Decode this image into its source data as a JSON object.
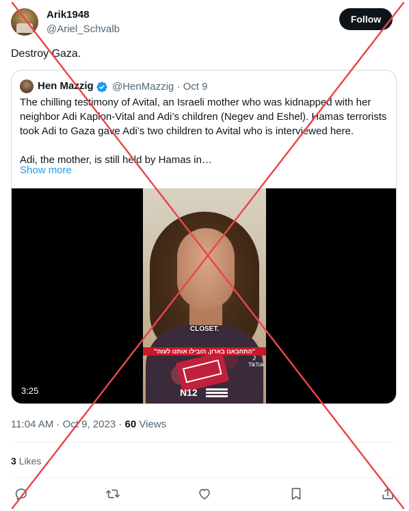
{
  "author": {
    "display_name": "Arik1948",
    "handle": "@Ariel_Schvalb",
    "follow_label": "Follow"
  },
  "tweet": {
    "text": "Destroy Gaza."
  },
  "quoted": {
    "display_name": "Hen Mazzig",
    "meta": "@HenMazzig · Oct 9",
    "paragraph1": "The chilling testimony of Avital, an Israeli mother who was kidnapped with her neighbor Adi Kaplon-Vital and Adi’s children (Negev and Eshel). Hamas terrorists took Adi to Gaza gave Adi’s two children to Avital who is interviewed here.",
    "paragraph2": "Adi, the mother, is still held by Hamas in…",
    "show_more": "Show more",
    "video": {
      "duration": "3:25",
      "caption": "CLOSET.",
      "subtitle": "\"התחבאנו בארון, הובילו אותנו לעזה\"",
      "tiktok": "TikTok",
      "logo": "N12"
    }
  },
  "footer": {
    "time_date": "11:04 AM · Oct 9, 2023 · ",
    "views_count": "60",
    "views_label": " Views",
    "likes_count": "3",
    "likes_label": " Likes"
  },
  "icons": {
    "reply": "reply-icon",
    "retweet": "retweet-icon",
    "like": "heart-icon",
    "bookmark": "bookmark-icon",
    "share": "share-icon"
  },
  "colors": {
    "accent": "#1d9bf0",
    "overlay_x": "#e8474a"
  }
}
